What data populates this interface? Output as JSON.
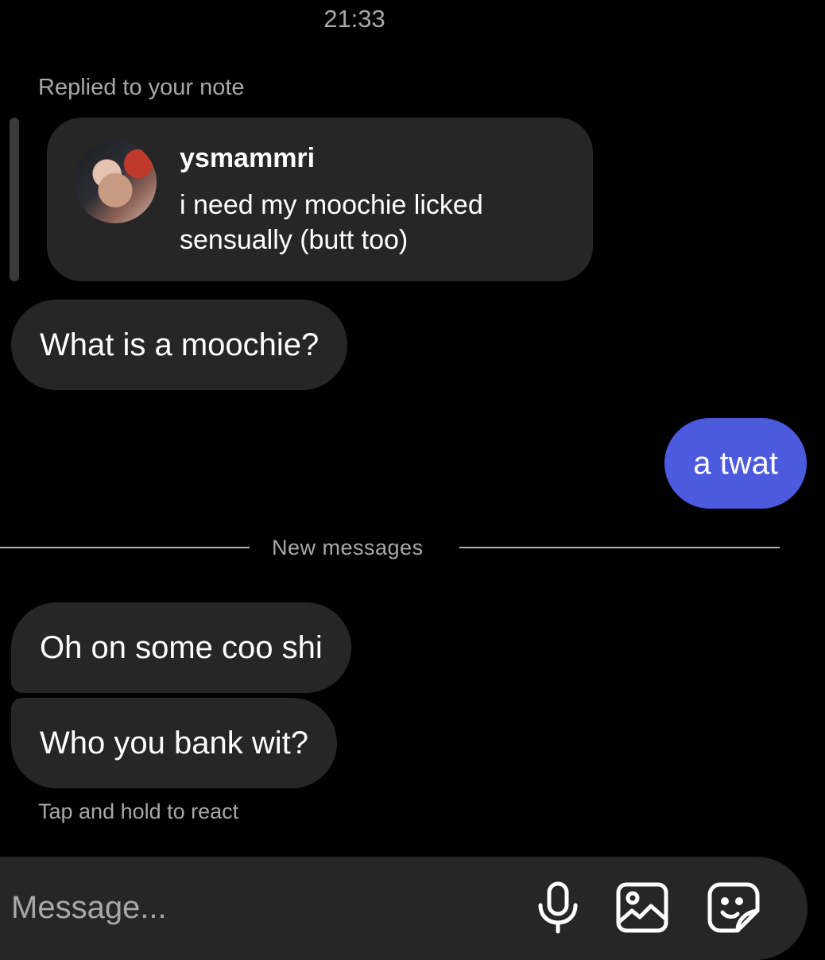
{
  "header": {
    "time": "21:33"
  },
  "reply_context": {
    "caption": "Replied to your note",
    "note": {
      "username": "ysmammri",
      "text": "i need my moochie licked sensually (butt too)"
    }
  },
  "messages": [
    {
      "text": "What is a moochie?",
      "direction": "incoming"
    },
    {
      "text": "a twat",
      "direction": "outgoing"
    },
    {
      "text": "Oh on some coo shi",
      "direction": "incoming"
    },
    {
      "text": "Who you bank wit?",
      "direction": "incoming"
    }
  ],
  "divider": {
    "label": "New messages"
  },
  "hint": "Tap and hold to react",
  "composer": {
    "placeholder": "Message...",
    "icons": [
      "microphone-icon",
      "image-icon",
      "sticker-icon"
    ]
  },
  "colors": {
    "background": "#000000",
    "incoming_bubble": "#262626",
    "outgoing_bubble": "#4c5ae0",
    "secondary_text": "#a8a8a8"
  }
}
